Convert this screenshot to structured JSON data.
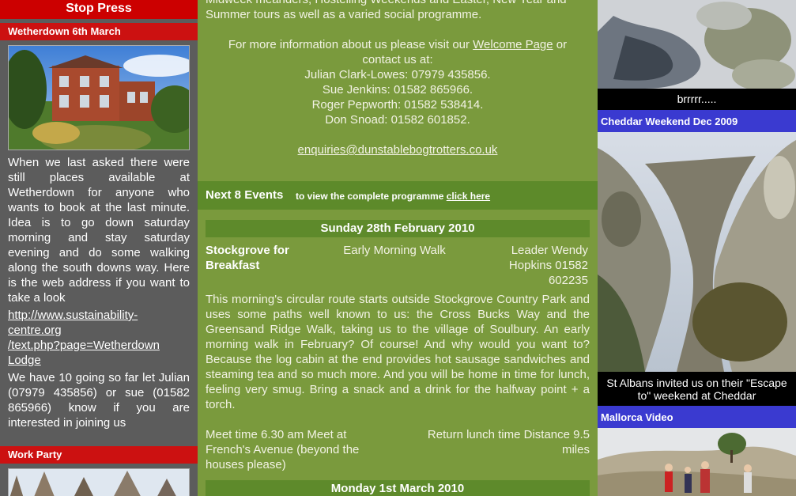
{
  "left": {
    "stop_press": "Stop Press",
    "wetherdown": {
      "heading": "Wetherdown 6th March",
      "image_alt": "House at Wetherdown",
      "para1": "When we last asked there were still places available at Wetherdown for anyone who wants to book at the last minute. Idea is to go down saturday morning and stay saturday evening and do some walking along the south downs way. Here is the web address if you want to take a look",
      "link_lines": [
        "http://www.sustainability-",
        "centre.org",
        "/text.php?page=Wetherdown",
        "Lodge"
      ],
      "para2": "We have 10 going so far let Julian (07979 435856) or sue (01582 865966) know if you are interested in joining us"
    },
    "work_party": {
      "heading": "Work Party"
    }
  },
  "mid": {
    "intro_lines": [
      "Midweek meanders, Hostelling Weekends and Easter, New Year and",
      "Summer tours as well as a varied social programme."
    ],
    "more_info_pre": "For more information about us please visit our ",
    "welcome_link": "Welcome Page",
    "more_info_post": " or",
    "contact_at": "contact us at:",
    "contacts": [
      "Julian Clark-Lowes: 07979 435856.",
      "Sue Jenkins: 01582 865966.",
      "Roger Pepworth: 01582 538414.",
      "Don Snoad: 01582 601852."
    ],
    "email": "enquiries@dunstablebogtrotters.co.uk",
    "events": {
      "title": "Next 8 Events",
      "sub": "to view the complete programme ",
      "link": "click here"
    },
    "event1": {
      "date": "Sunday 28th February 2010",
      "title_lines": [
        "Stockgrove for",
        "Breakfast"
      ],
      "type": "Early Morning Walk",
      "leader_lines": [
        "Leader Wendy",
        "Hopkins 01582",
        "602235"
      ],
      "description": "This morning's circular route starts outside Stockgrove Country Park and uses some paths well known to us: the Cross Bucks Way and the Greensand Ridge Walk, taking us to the village of Soulbury.  An early morning walk in February?  Of course!  And why would you want to? Because the log cabin at the end provides hot sausage sandwiches and steaming tea and so much more.  And you will be home in time for lunch, feeling very smug.  Bring a snack and a drink for the halfway point + a torch.",
      "meet_lines": [
        "Meet time 6.30 am Meet at",
        "French's Avenue (beyond the",
        "houses please)"
      ],
      "return_lines": [
        "Return lunch time Distance 9.5",
        "miles"
      ]
    },
    "event2": {
      "date": "Monday 1st March 2010"
    }
  },
  "right": {
    "snow_caption": "brrrrr.....",
    "cheddar": {
      "heading": "Cheddar Weekend Dec 2009",
      "caption_lines": [
        "St Albans invited us on their \"Escape",
        "to\" weekend at Cheddar"
      ]
    },
    "mallorca": {
      "heading": "Mallorca Video"
    }
  }
}
